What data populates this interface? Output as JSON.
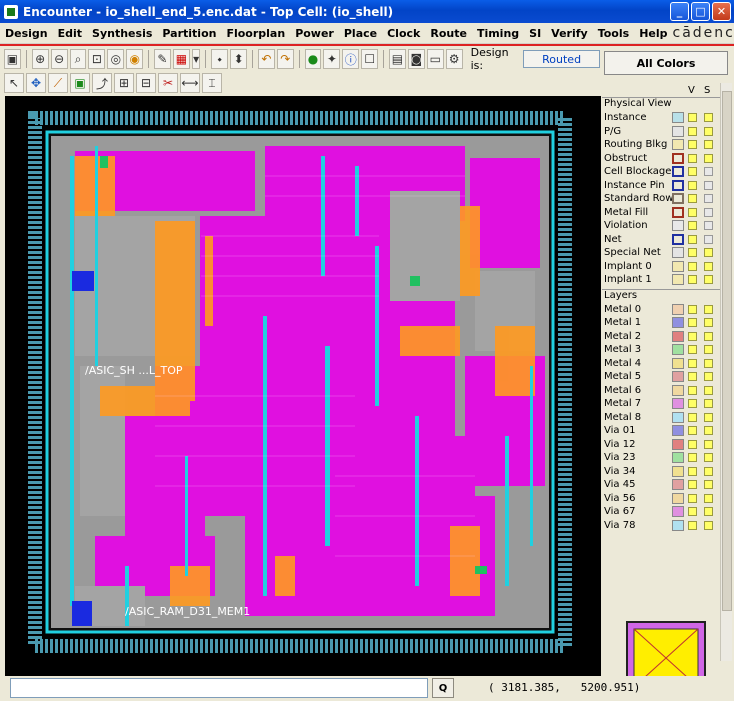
{
  "window": {
    "title": "Encounter - io_shell_end_5.enc.dat - Top Cell: (io_shell)",
    "buttons": {
      "minimize": "_",
      "maximize": "□",
      "close": "✕"
    }
  },
  "menu": [
    "Design",
    "Edit",
    "Synthesis",
    "Partition",
    "Floorplan",
    "Power",
    "Place",
    "Clock",
    "Route",
    "Timing",
    "SI",
    "Verify",
    "Tools",
    "Help"
  ],
  "brand": "cādence",
  "toolbar": {
    "design_label": "Design is:",
    "design_status": "Routed"
  },
  "icons": {
    "row1": [
      "zoom-in-icon",
      "zoom-out-icon",
      "zoom-area-icon",
      "fit-icon",
      "zoom-prev-icon",
      "redraw-icon",
      "select-icon",
      "color-pattern-icon",
      "undo-icon",
      "redo-icon",
      "pan-icon",
      "attributes-icon",
      "info-icon",
      "notes-icon",
      "design-browser-icon",
      "screenshot-icon",
      "layout-icon",
      "tools-icon"
    ],
    "row2": [
      "pointer-icon",
      "move-icon",
      "wire-edit-icon",
      "add-wire-icon",
      "split-icon",
      "ruler-icon",
      "cut-icon",
      "stretch-icon",
      "spread-icon",
      "mark-icon"
    ]
  },
  "canvas": {
    "labels": {
      "top_block": "/ASIC_SH ...L_TOP",
      "bottom_block": "/ASIC_RAM_D31_MEM1"
    },
    "colors": {
      "background": "#000000",
      "magenta": "#e010e0",
      "gray": "#9a9a9a",
      "orange": "#ff9a20",
      "cyan": "#20d0e0",
      "blue": "#1a2ae0",
      "green": "#20c060"
    }
  },
  "panel": {
    "all_colors_label": "All Colors",
    "header_v": "V",
    "header_s": "S",
    "physical_view_label": "Physical View",
    "physical_items": [
      {
        "label": "Instance",
        "color": "#b8e0e8"
      },
      {
        "label": "P/G",
        "color": "#e4e4e4"
      },
      {
        "label": "Routing Blkg",
        "color": "#f2e8b0"
      },
      {
        "label": "Obstruct",
        "color": "#ece9d8",
        "border": "#a03020"
      },
      {
        "label": "Cell Blockage",
        "color": "#ece9d8",
        "border": "#2030a0"
      },
      {
        "label": "Instance Pin",
        "color": "#ece9d8",
        "border": "#2030a0"
      },
      {
        "label": "Standard Row",
        "color": "#ece9d8",
        "border": "#807060"
      },
      {
        "label": "Metal Fill",
        "color": "#ece9d8",
        "border": "#a03020"
      },
      {
        "label": "Violation",
        "color": "#e8e8e8"
      },
      {
        "label": "Net",
        "color": "#ece9d8",
        "border": "#2030a0"
      },
      {
        "label": "Special Net",
        "color": "#e4e4e4"
      },
      {
        "label": "Implant 0",
        "color": "#f2e8b0"
      },
      {
        "label": "Implant 1",
        "color": "#f2e8b0"
      }
    ],
    "layers_label": "Layers",
    "layer_items": [
      {
        "label": "Metal 0",
        "color": "#f0d0b0"
      },
      {
        "label": "Metal 1",
        "color": "#9090e0"
      },
      {
        "label": "Metal 2",
        "color": "#e08080"
      },
      {
        "label": "Metal 3",
        "color": "#a0e0a0"
      },
      {
        "label": "Metal 4",
        "color": "#f0e090"
      },
      {
        "label": "Metal 5",
        "color": "#e0a0a0"
      },
      {
        "label": "Metal 6",
        "color": "#f0d8a0"
      },
      {
        "label": "Metal 7",
        "color": "#e090e0"
      },
      {
        "label": "Metal 8",
        "color": "#b0e0f0"
      },
      {
        "label": "Via 01",
        "color": "#9090e0"
      },
      {
        "label": "Via 12",
        "color": "#e08080"
      },
      {
        "label": "Via 23",
        "color": "#a0e0a0"
      },
      {
        "label": "Via 34",
        "color": "#f0e090"
      },
      {
        "label": "Via 45",
        "color": "#e0a0a0"
      },
      {
        "label": "Via 56",
        "color": "#f0d8a0"
      },
      {
        "label": "Via 67",
        "color": "#e090e0"
      },
      {
        "label": "Via 78",
        "color": "#b0e0f0"
      }
    ]
  },
  "status": {
    "command_value": "",
    "query_button": "Q",
    "coordinates": "( 3181.385,   5200.951)"
  }
}
